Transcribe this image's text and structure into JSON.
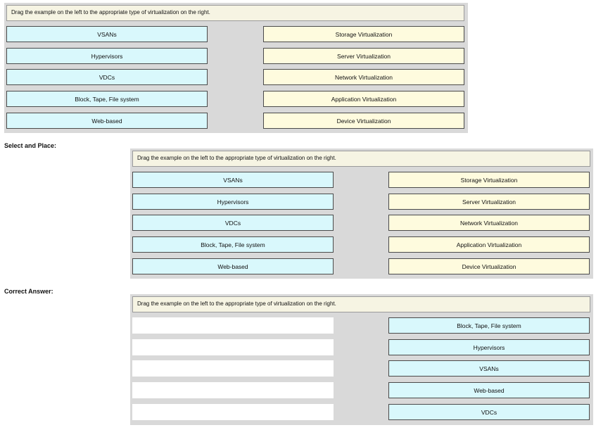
{
  "panels": [
    {
      "instruction": "Drag the example on the left to the appropriate type of virtualization on the right.",
      "left": [
        "VSANs",
        "Hypervisors",
        "VDCs",
        "Block, Tape, File system",
        "Web-based"
      ],
      "right": [
        "Storage Virtualization",
        "Server Virtualization",
        "Network Virtualization",
        "Application Virtualization",
        "Device Virtualization"
      ]
    },
    {
      "label": "Select and Place:",
      "instruction": "Drag the example on the left to the appropriate type of virtualization on the right.",
      "left": [
        "VSANs",
        "Hypervisors",
        "VDCs",
        "Block, Tape, File system",
        "Web-based"
      ],
      "right": [
        "Storage Virtualization",
        "Server Virtualization",
        "Network Virtualization",
        "Application Virtualization",
        "Device Virtualization"
      ]
    },
    {
      "label": "Correct Answer:",
      "instruction": "Drag the example on the left to the appropriate type of virtualization on the right.",
      "left": [
        "",
        "",
        "",
        "",
        ""
      ],
      "right": [
        "Block, Tape, File system",
        "Hypervisors",
        "VSANs",
        "Web-based",
        "VDCs"
      ]
    }
  ],
  "colors": {
    "source_fill": "#d9f8fc",
    "target_fill": "#fefbde",
    "panel_bg": "#d9d9d9"
  }
}
